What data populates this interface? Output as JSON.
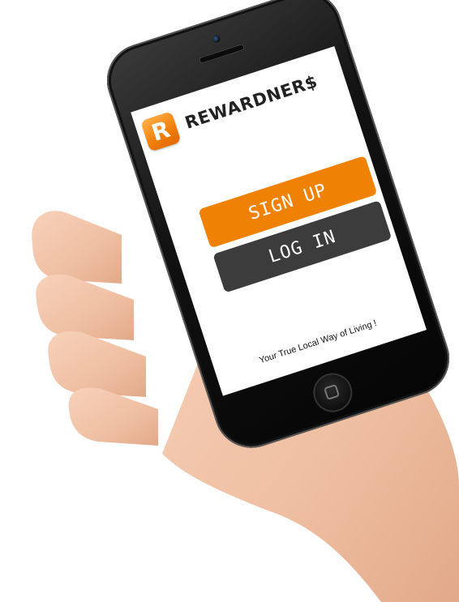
{
  "app": {
    "title": "REWARDNER$",
    "logo_letter": "R",
    "accent_color": "#ef8205",
    "dark_color": "#3c3c3c"
  },
  "buttons": {
    "signup_label": "SIGN UP",
    "login_label": "LOG IN"
  },
  "tagline": "Your True Local Way of Living !",
  "icons": {
    "logo": "rewardners-logo-icon",
    "home": "home-button-icon"
  }
}
